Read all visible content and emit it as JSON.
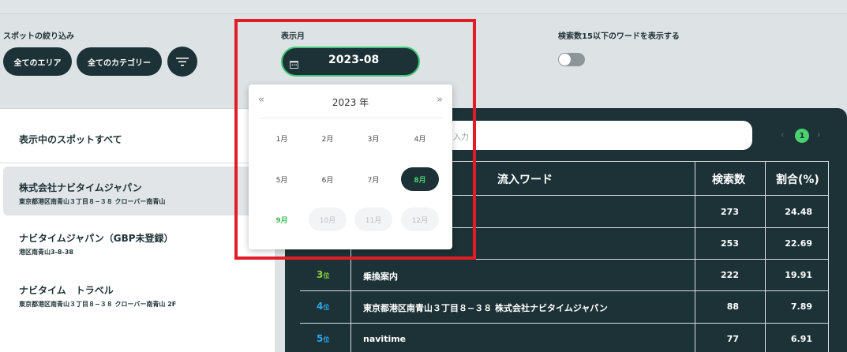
{
  "filters": {
    "spot_label": "スポットの絞り込み",
    "area_button": "全てのエリア",
    "category_button": "全てのカテゴリー",
    "month_label": "表示月",
    "month_value": "2023-08",
    "toggle_label": "検索数15以下のワードを表示する"
  },
  "calendar": {
    "year": "2023 年",
    "prev": "«",
    "next": "»",
    "months": [
      "1月",
      "2月",
      "3月",
      "4月",
      "5月",
      "6月",
      "7月",
      "8月",
      "9月",
      "10月",
      "11月",
      "12月"
    ]
  },
  "spots": {
    "header": "表示中のスポットすべて",
    "items": [
      {
        "name": "株式会社ナビタイムジャパン",
        "address": "東京都港区南青山３丁目８−３８ クローバー南青山"
      },
      {
        "name": "ナビタイムジャパン（GBP未登録）",
        "address": "港区南青山3-8-38"
      },
      {
        "name": "ナビタイム　トラベル",
        "address": "東京都港区南青山３丁目８−３８ クローバー南青山 2F"
      }
    ]
  },
  "search": {
    "placeholder_fragment": "を入力"
  },
  "pager": {
    "prev": "‹",
    "page": "1",
    "next": "›"
  },
  "table": {
    "headers": {
      "word": "流入ワード",
      "count": "検索数",
      "ratio": "割合(%)"
    },
    "rows": [
      {
        "rank": "",
        "rank_suffix": "",
        "word": "",
        "count": "273",
        "ratio": "24.48"
      },
      {
        "rank": "",
        "rank_suffix": "",
        "word": "",
        "count": "253",
        "ratio": "22.69"
      },
      {
        "rank": "3",
        "rank_suffix": "位",
        "word": "乗換案内",
        "count": "222",
        "ratio": "19.91"
      },
      {
        "rank": "4",
        "rank_suffix": "位",
        "word": "東京都港区南青山３丁目８−３８ 株式会社ナビタイムジャパン",
        "count": "88",
        "ratio": "7.89"
      },
      {
        "rank": "5",
        "rank_suffix": "位",
        "word": "navitime",
        "count": "77",
        "ratio": "6.91"
      }
    ]
  },
  "colors": {
    "dark": "#1c3236",
    "accent_green": "#4ad06f",
    "rank3": "#8bd13e",
    "rank4": "#2fa6e8",
    "highlight_red": "#e11d28"
  }
}
